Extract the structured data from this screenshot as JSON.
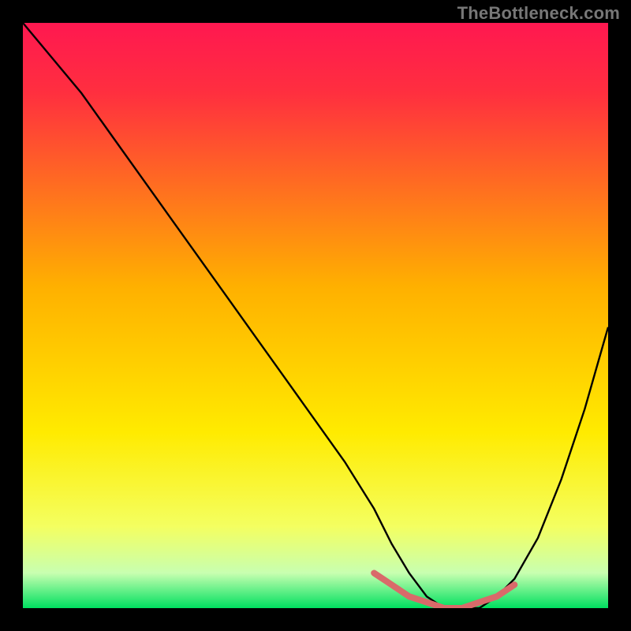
{
  "watermark": "TheBottleneck.com",
  "colors": {
    "gradient_stops": [
      {
        "offset": 0.0,
        "color": "#ff1850"
      },
      {
        "offset": 0.12,
        "color": "#ff2f3f"
      },
      {
        "offset": 0.45,
        "color": "#ffb000"
      },
      {
        "offset": 0.7,
        "color": "#ffeb00"
      },
      {
        "offset": 0.86,
        "color": "#f4ff60"
      },
      {
        "offset": 0.94,
        "color": "#c8ffb0"
      },
      {
        "offset": 1.0,
        "color": "#00e060"
      }
    ],
    "curve": "#000000",
    "accent": "#d96a6a",
    "background": "#000000"
  },
  "chart_data": {
    "type": "line",
    "title": "",
    "xlabel": "",
    "ylabel": "",
    "xlim": [
      0,
      100
    ],
    "ylim": [
      0,
      100
    ],
    "grid": false,
    "legend": false,
    "x": [
      0,
      5,
      10,
      15,
      20,
      25,
      30,
      35,
      40,
      45,
      50,
      55,
      60,
      63,
      66,
      69,
      72,
      75,
      78,
      81,
      84,
      88,
      92,
      96,
      100
    ],
    "y": [
      100,
      94,
      88,
      81,
      74,
      67,
      60,
      53,
      46,
      39,
      32,
      25,
      17,
      11,
      6,
      2,
      0,
      0,
      0,
      2,
      5,
      12,
      22,
      34,
      48
    ],
    "accent_segment": {
      "x": [
        60,
        63,
        66,
        69,
        72,
        75,
        78,
        81,
        84
      ],
      "y": [
        6,
        4,
        2,
        1,
        0,
        0,
        1,
        2,
        4
      ]
    },
    "annotations": []
  }
}
